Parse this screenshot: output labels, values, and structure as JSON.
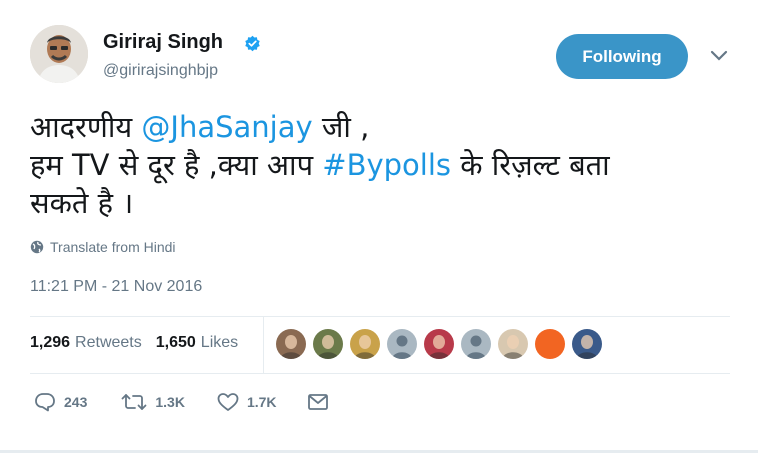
{
  "tweet": {
    "author_name": "Giriraj Singh",
    "author_handle": "@girirajsinghbjp",
    "follow_label": "Following",
    "line1_a": "आदरणीय ",
    "line1_mention": "@JhaSanjay",
    "line1_b": " जी ,",
    "line2_a": "हम TV से दूर है ,क्या आप ",
    "line2_hashtag": "#Bypolls",
    "line2_b": " के रिज़ल्ट बता",
    "line3": "सकते है ।",
    "translate_label": "Translate from Hindi",
    "timestamp": "11:21 PM - 21 Nov 2016"
  },
  "stats": {
    "retweets_count": "1,296",
    "retweets_label": "Retweets",
    "likes_count": "1,650",
    "likes_label": "Likes"
  },
  "actions": {
    "replies": "243",
    "retweets": "1.3K",
    "likes": "1.7K"
  },
  "icons": {
    "verified": "verified-badge-icon",
    "caret": "chevron-down-icon",
    "globe": "globe-icon",
    "reply": "reply-icon",
    "retweet": "retweet-icon",
    "like": "heart-icon",
    "dm": "envelope-icon"
  },
  "colors": {
    "follow_button": "#3a95c8",
    "link": "#1b95e0",
    "secondary_text": "#657786",
    "verified": "#1da1f2"
  },
  "likers": [
    {
      "bg": "#8a6a52"
    },
    {
      "bg": "#6b7a4a"
    },
    {
      "bg": "#c9a24a"
    },
    {
      "bg": "#aab8c2"
    },
    {
      "bg": "#b83a4a"
    },
    {
      "bg": "#aab8c2"
    },
    {
      "bg": "#d8c8b0"
    },
    {
      "bg": "#f26522"
    },
    {
      "bg": "#3a5a8a"
    }
  ]
}
